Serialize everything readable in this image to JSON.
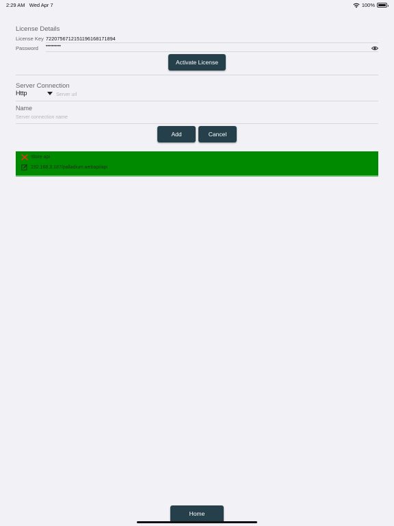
{
  "status_bar": {
    "time": "2:29 AM",
    "date": "Wed Apr 7",
    "battery_text": "100%",
    "battery_level": 1.0
  },
  "license": {
    "section_title": "License Details",
    "key_label": "License Key",
    "key_value": "722075671215119616817189​4",
    "password_label": "Password",
    "password_value": "••••••••••",
    "activate_label": "Activate License"
  },
  "server": {
    "section_title": "Server Connection",
    "protocol_value": "Http",
    "url_placeholder": "Server url",
    "name_label": "Name",
    "name_placeholder": "Server connection name",
    "add_label": "Add",
    "cancel_label": "Cancel"
  },
  "connections": [
    {
      "name": "Store api",
      "url": "192.168.3.187/palladium.webapi/api"
    }
  ],
  "footer": {
    "home_label": "Home"
  },
  "colors": {
    "accent": "#253f4b",
    "row_bg": "#008a00",
    "background": "#f2f2f6"
  }
}
